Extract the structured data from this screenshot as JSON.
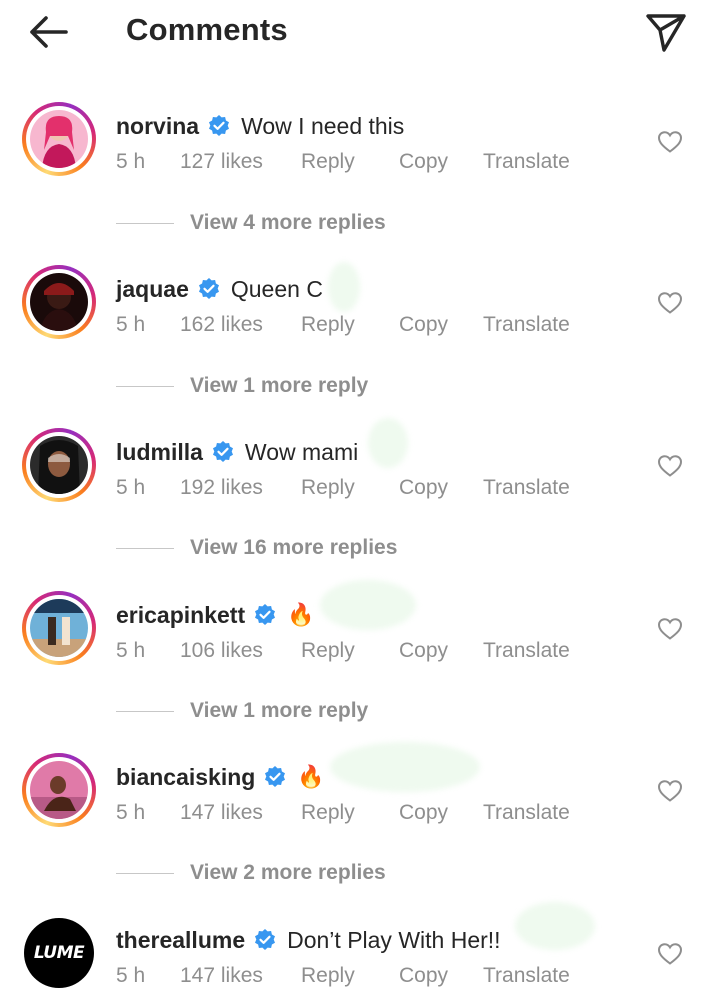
{
  "header": {
    "title": "Comments",
    "back_icon": "arrow-left-icon",
    "send_icon": "paper-plane-icon"
  },
  "comments": [
    {
      "username": "norvina",
      "verified": true,
      "text": "Wow I need this",
      "time": "5 h",
      "likes": "127 likes",
      "reply": "Reply",
      "copy": "Copy",
      "translate": "Translate",
      "view_replies": "View 4 more replies"
    },
    {
      "username": "jaquae",
      "verified": true,
      "text": "Queen C",
      "time": "5 h",
      "likes": "162 likes",
      "reply": "Reply",
      "copy": "Copy",
      "translate": "Translate",
      "view_replies": "View 1 more reply"
    },
    {
      "username": "ludmilla",
      "verified": true,
      "text": "Wow mami",
      "time": "5 h",
      "likes": "192 likes",
      "reply": "Reply",
      "copy": "Copy",
      "translate": "Translate",
      "view_replies": "View 16 more replies"
    },
    {
      "username": "ericapinkett",
      "verified": true,
      "text": "🔥",
      "time": "5 h",
      "likes": "106 likes",
      "reply": "Reply",
      "copy": "Copy",
      "translate": "Translate",
      "view_replies": "View 1 more reply"
    },
    {
      "username": "biancaisking",
      "verified": true,
      "text": "🔥",
      "time": "5 h",
      "likes": "147 likes",
      "reply": "Reply",
      "copy": "Copy",
      "translate": "Translate",
      "view_replies": "View 2 more replies"
    },
    {
      "username": "thereallume",
      "verified": true,
      "text": "Don’t Play With Her!!",
      "time": "5 h",
      "likes": "147 likes",
      "reply": "Reply",
      "copy": "Copy",
      "translate": "Translate",
      "avatar_text": "LUME"
    }
  ],
  "colors": {
    "text": "#262626",
    "muted": "#8e8e8e",
    "verified": "#3897f0"
  }
}
